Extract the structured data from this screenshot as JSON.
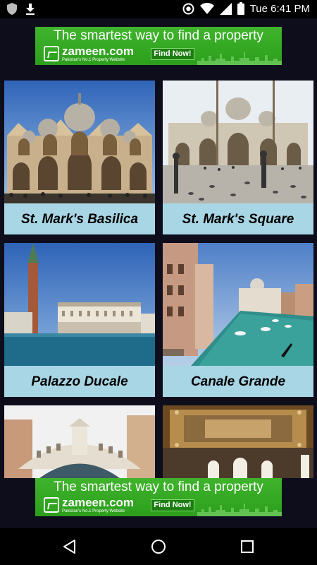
{
  "status_bar": {
    "time": "Tue 6:41 PM",
    "icons": [
      "shield-icon",
      "download-icon",
      "data-saver-icon",
      "wifi-icon",
      "signal-icon",
      "battery-icon"
    ]
  },
  "ads": {
    "top": {
      "tagline": "The smartest way to find a property",
      "brand": "zameen.com",
      "sub": "Pakistan's No.1 Property Website",
      "button": "Find Now!"
    },
    "bottom": {
      "tagline": "The smartest way to find a property",
      "brand": "zameen.com",
      "sub": "Pakistan's No.1 Property Website",
      "button": "Find Now!"
    },
    "color": "#35a924"
  },
  "places": [
    {
      "name": "St. Mark's Basilica"
    },
    {
      "name": "St. Mark's Square"
    },
    {
      "name": "Palazzo Ducale"
    },
    {
      "name": "Canale Grande"
    },
    {
      "name": ""
    },
    {
      "name": ""
    }
  ],
  "colors": {
    "caption_bg": "#a9d6e5",
    "page_bg": "#0d0d1c"
  },
  "nav": {
    "icons": [
      "back-icon",
      "home-icon",
      "recents-icon"
    ]
  }
}
